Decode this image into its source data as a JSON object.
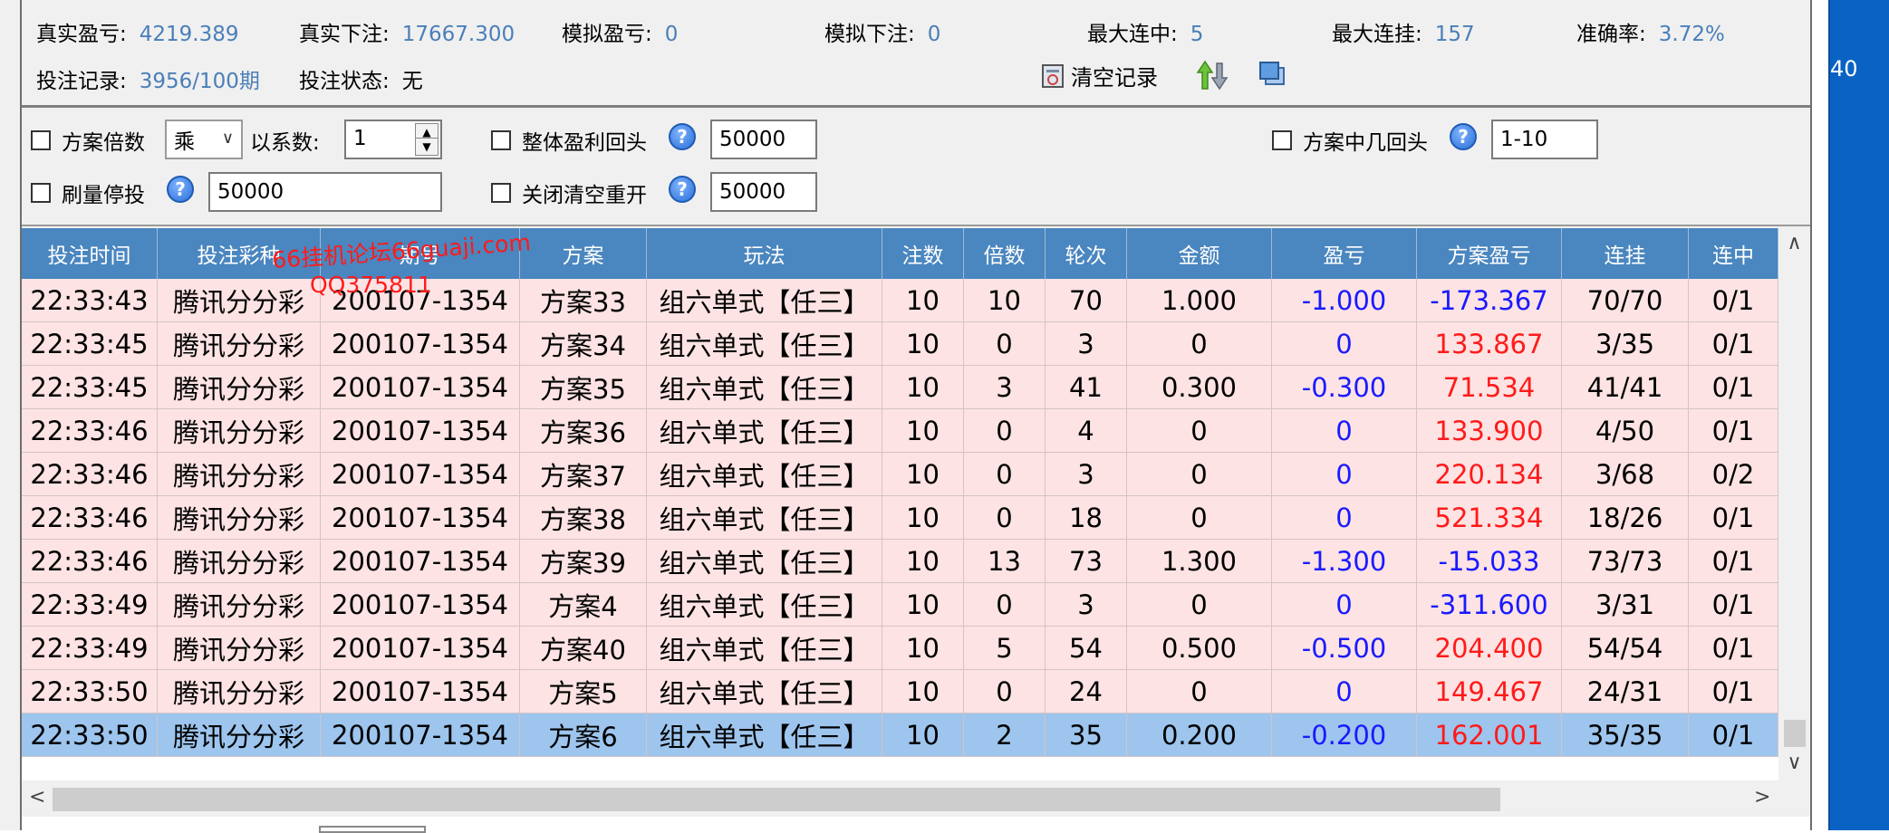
{
  "stats": {
    "real_pl_label": "真实盈亏:",
    "real_pl_value": "4219.389",
    "real_bet_label": "真实下注:",
    "real_bet_value": "17667.300",
    "sim_pl_label": "模拟盈亏:",
    "sim_pl_value": "0",
    "sim_bet_label": "模拟下注:",
    "sim_bet_value": "0",
    "max_win_streak_label": "最大连中:",
    "max_win_streak_value": "5",
    "max_loss_streak_label": "最大连挂:",
    "max_loss_streak_value": "157",
    "accuracy_label": "准确率:",
    "accuracy_value": "3.72%",
    "bet_record_label": "投注记录:",
    "bet_record_value": "3956/100期",
    "bet_status_label": "投注状态:",
    "bet_status_value": "无",
    "clear_records_label": "清空记录"
  },
  "options": {
    "plan_multiplier_label": "方案倍数",
    "operator_select": "乘",
    "coefficient_label": "以系数:",
    "coefficient_value": "1",
    "overall_profit_label": "整体盈利回头",
    "overall_profit_value": "50000",
    "plan_hit_label": "方案中几回头",
    "plan_hit_value": "1-10",
    "volume_stop_label": "刷量停投",
    "volume_stop_value": "50000",
    "close_clear_label": "关闭清空重开",
    "close_clear_value": "50000"
  },
  "table": {
    "columns": [
      "投注时间",
      "投注彩种",
      "期号",
      "方案",
      "玩法",
      "注数",
      "倍数",
      "轮次",
      "金额",
      "盈亏",
      "方案盈亏",
      "连挂",
      "连中"
    ],
    "rows": [
      {
        "time": "22:33:43",
        "lottery": "腾讯分分彩",
        "issue": "200107-1354",
        "plan": "方案33",
        "play": "组六单式【任三】",
        "notes": "10",
        "mult": "10",
        "round": "70",
        "amount": "1.000",
        "pl": "-1.000",
        "plan_pl": "-173.367",
        "loss_streak": "70/70",
        "win_streak": "0/1"
      },
      {
        "time": "22:33:45",
        "lottery": "腾讯分分彩",
        "issue": "200107-1354",
        "plan": "方案34",
        "play": "组六单式【任三】",
        "notes": "10",
        "mult": "0",
        "round": "3",
        "amount": "0",
        "pl": "0",
        "plan_pl": "133.867",
        "loss_streak": "3/35",
        "win_streak": "0/1"
      },
      {
        "time": "22:33:45",
        "lottery": "腾讯分分彩",
        "issue": "200107-1354",
        "plan": "方案35",
        "play": "组六单式【任三】",
        "notes": "10",
        "mult": "3",
        "round": "41",
        "amount": "0.300",
        "pl": "-0.300",
        "plan_pl": "71.534",
        "loss_streak": "41/41",
        "win_streak": "0/1"
      },
      {
        "time": "22:33:46",
        "lottery": "腾讯分分彩",
        "issue": "200107-1354",
        "plan": "方案36",
        "play": "组六单式【任三】",
        "notes": "10",
        "mult": "0",
        "round": "4",
        "amount": "0",
        "pl": "0",
        "plan_pl": "133.900",
        "loss_streak": "4/50",
        "win_streak": "0/1"
      },
      {
        "time": "22:33:46",
        "lottery": "腾讯分分彩",
        "issue": "200107-1354",
        "plan": "方案37",
        "play": "组六单式【任三】",
        "notes": "10",
        "mult": "0",
        "round": "3",
        "amount": "0",
        "pl": "0",
        "plan_pl": "220.134",
        "loss_streak": "3/68",
        "win_streak": "0/2"
      },
      {
        "time": "22:33:46",
        "lottery": "腾讯分分彩",
        "issue": "200107-1354",
        "plan": "方案38",
        "play": "组六单式【任三】",
        "notes": "10",
        "mult": "0",
        "round": "18",
        "amount": "0",
        "pl": "0",
        "plan_pl": "521.334",
        "loss_streak": "18/26",
        "win_streak": "0/1"
      },
      {
        "time": "22:33:46",
        "lottery": "腾讯分分彩",
        "issue": "200107-1354",
        "plan": "方案39",
        "play": "组六单式【任三】",
        "notes": "10",
        "mult": "13",
        "round": "73",
        "amount": "1.300",
        "pl": "-1.300",
        "plan_pl": "-15.033",
        "loss_streak": "73/73",
        "win_streak": "0/1"
      },
      {
        "time": "22:33:49",
        "lottery": "腾讯分分彩",
        "issue": "200107-1354",
        "plan": "方案4",
        "play": "组六单式【任三】",
        "notes": "10",
        "mult": "0",
        "round": "3",
        "amount": "0",
        "pl": "0",
        "plan_pl": "-311.600",
        "loss_streak": "3/31",
        "win_streak": "0/1"
      },
      {
        "time": "22:33:49",
        "lottery": "腾讯分分彩",
        "issue": "200107-1354",
        "plan": "方案40",
        "play": "组六单式【任三】",
        "notes": "10",
        "mult": "5",
        "round": "54",
        "amount": "0.500",
        "pl": "-0.500",
        "plan_pl": "204.400",
        "loss_streak": "54/54",
        "win_streak": "0/1"
      },
      {
        "time": "22:33:50",
        "lottery": "腾讯分分彩",
        "issue": "200107-1354",
        "plan": "方案5",
        "play": "组六单式【任三】",
        "notes": "10",
        "mult": "0",
        "round": "24",
        "amount": "0",
        "pl": "0",
        "plan_pl": "149.467",
        "loss_streak": "24/31",
        "win_streak": "0/1"
      },
      {
        "time": "22:33:50",
        "lottery": "腾讯分分彩",
        "issue": "200107-1354",
        "plan": "方案6",
        "play": "组六单式【任三】",
        "notes": "10",
        "mult": "2",
        "round": "35",
        "amount": "0.200",
        "pl": "-0.200",
        "plan_pl": "162.001",
        "loss_streak": "35/35",
        "win_streak": "0/1",
        "selected": true
      }
    ]
  },
  "watermark": {
    "line1": "66挂机论坛66guaji.com",
    "line2": "QQ375811"
  },
  "right_strip_text": "40",
  "colors": {
    "header": "#4a86bf",
    "row": "#fde3e3",
    "selected": "#9dc5ee",
    "negative": "#1a1aff",
    "positive": "#ff1a1a",
    "stat_value": "#4a7fb8"
  },
  "icons": {
    "clear": "clear-record-icon",
    "sort": "up-down-arrows-icon",
    "window": "window-copy-icon",
    "help": "help-icon"
  }
}
